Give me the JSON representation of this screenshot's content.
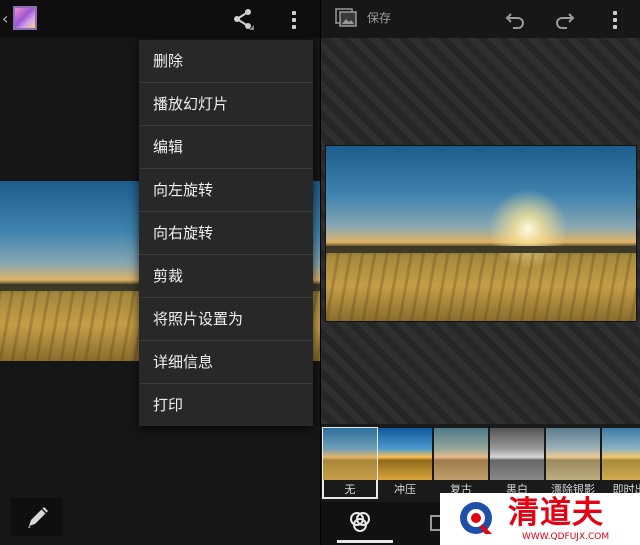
{
  "left_panel": {
    "back_glyph": "‹",
    "menu_items": [
      "删除",
      "播放幻灯片",
      "编辑",
      "向左旋转",
      "向右旋转",
      "剪裁",
      "将照片设置为",
      "详细信息",
      "打印"
    ]
  },
  "right_panel": {
    "save_label": "保存",
    "filters": [
      {
        "label": "无",
        "selected": true
      },
      {
        "label": "冲压",
        "selected": false
      },
      {
        "label": "复古",
        "selected": false
      },
      {
        "label": "黑白",
        "selected": false
      },
      {
        "label": "漂除银影",
        "selected": false
      },
      {
        "label": "即时出",
        "selected": false
      }
    ]
  },
  "watermark": {
    "title": "清道夫",
    "url": "WWW.QDFUJX.COM"
  },
  "colors": {
    "accent_red": "#e60012",
    "menu_bg": "#282828"
  }
}
